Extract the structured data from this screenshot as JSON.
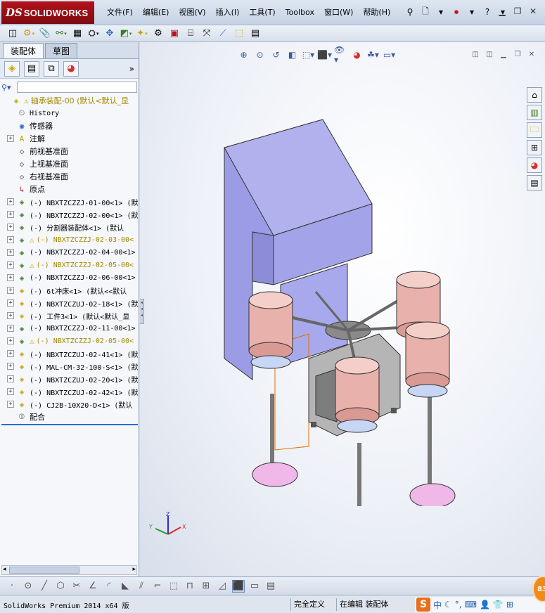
{
  "app": {
    "logo_prefix": "DS",
    "logo_name": "SOLIDWORKS"
  },
  "menu": [
    {
      "label": "文件(F)"
    },
    {
      "label": "编辑(E)"
    },
    {
      "label": "视图(V)"
    },
    {
      "label": "插入(I)"
    },
    {
      "label": "工具(T)"
    },
    {
      "label": "Toolbox"
    },
    {
      "label": "窗口(W)"
    },
    {
      "label": "帮助(H)"
    }
  ],
  "panel": {
    "tabs": [
      {
        "label": "装配体",
        "active": true
      },
      {
        "label": "草图",
        "active": false
      }
    ],
    "expand_label": "»"
  },
  "tree": [
    {
      "label": "轴承装配-00  (默认<默认_显",
      "icon": "assembly-icon",
      "warning": true,
      "expand": "",
      "cn": true,
      "root": true
    },
    {
      "label": "History",
      "icon": "history-icon",
      "expand": "",
      "cn": false
    },
    {
      "label": "传感器",
      "icon": "sensor-icon",
      "expand": "",
      "cn": true
    },
    {
      "label": "注解",
      "icon": "annotation-icon",
      "expand": "+",
      "cn": true
    },
    {
      "label": "前视基准面",
      "icon": "plane-icon",
      "expand": "",
      "cn": true
    },
    {
      "label": "上视基准面",
      "icon": "plane-icon",
      "expand": "",
      "cn": true
    },
    {
      "label": "右视基准面",
      "icon": "plane-icon",
      "expand": "",
      "cn": true
    },
    {
      "label": "原点",
      "icon": "origin-icon",
      "expand": "",
      "cn": true
    },
    {
      "label": "(-) NBXTZCZZJ-01-00<1> (默",
      "icon": "subassembly-icon",
      "expand": "+",
      "cn": false
    },
    {
      "label": "(-) NBXTZCZZJ-02-00<1> (默",
      "icon": "subassembly-icon",
      "expand": "+",
      "cn": false
    },
    {
      "label": "(-) 分割器装配体<1> (默认",
      "icon": "subassembly-icon",
      "expand": "+",
      "cn": false
    },
    {
      "label": "(-) NBXTZCZZJ-02-03-00<",
      "icon": "subassembly-icon",
      "warning": true,
      "expand": "+",
      "cn": false
    },
    {
      "label": "(-) NBXTZCZZJ-02-04-00<1>",
      "icon": "subassembly-icon",
      "expand": "+",
      "cn": false
    },
    {
      "label": "(-) NBXTZCZZJ-02-05-00<",
      "icon": "subassembly-icon",
      "warning": true,
      "expand": "+",
      "cn": false
    },
    {
      "label": "(-) NBXTZCZZJ-02-06-00<1>",
      "icon": "subassembly-icon",
      "expand": "+",
      "cn": false
    },
    {
      "label": "(-) 6t冲床<1> (默认<<默认",
      "icon": "part-icon",
      "expand": "+",
      "cn": false
    },
    {
      "label": "(-) NBXTZCZUJ-02-18<1> (默",
      "icon": "part-icon",
      "expand": "+",
      "cn": false
    },
    {
      "label": "(-) 工件3<1> (默认<默认_显",
      "icon": "part-icon",
      "expand": "+",
      "cn": false
    },
    {
      "label": "(-) NBXTZCZZJ-02-11-00<1>",
      "icon": "subassembly-icon",
      "expand": "+",
      "cn": false
    },
    {
      "label": "(-) NBXTZCZZJ-02-05-00<",
      "icon": "subassembly-icon",
      "warning": true,
      "expand": "+",
      "cn": false
    },
    {
      "label": "(-) NBXTZCZUJ-02-41<1> (默",
      "icon": "part-icon",
      "expand": "+",
      "cn": false
    },
    {
      "label": "(-) MAL-CM-32-100-S<1> (默",
      "icon": "part-icon",
      "expand": "+",
      "cn": false
    },
    {
      "label": "(-) NBXTZCZUJ-02-20<1> (默",
      "icon": "part-icon",
      "expand": "+",
      "cn": false
    },
    {
      "label": "(-) NBXTZCZUJ-02-42<1> (默",
      "icon": "part-icon",
      "expand": "+",
      "cn": false
    },
    {
      "label": "(-) CJ2B-10X20-D<1> (默认",
      "icon": "part-icon",
      "expand": "+",
      "cn": false
    },
    {
      "label": "配合",
      "icon": "mates-icon",
      "expand": "",
      "cn": true
    }
  ],
  "triad": {
    "x": "X",
    "y": "Y",
    "z": "Z"
  },
  "status": {
    "product": "SolidWorks Premium 2014 x64 版",
    "definition": "完全定义",
    "mode": "在编辑 装配体"
  },
  "ime": {
    "logo": "S",
    "lang": "中"
  },
  "badge": "83",
  "colors": {
    "brand": "#b3121b",
    "press": "#9b9be6",
    "bucket": "#e8b1ab",
    "base": "#f0b8e8"
  }
}
